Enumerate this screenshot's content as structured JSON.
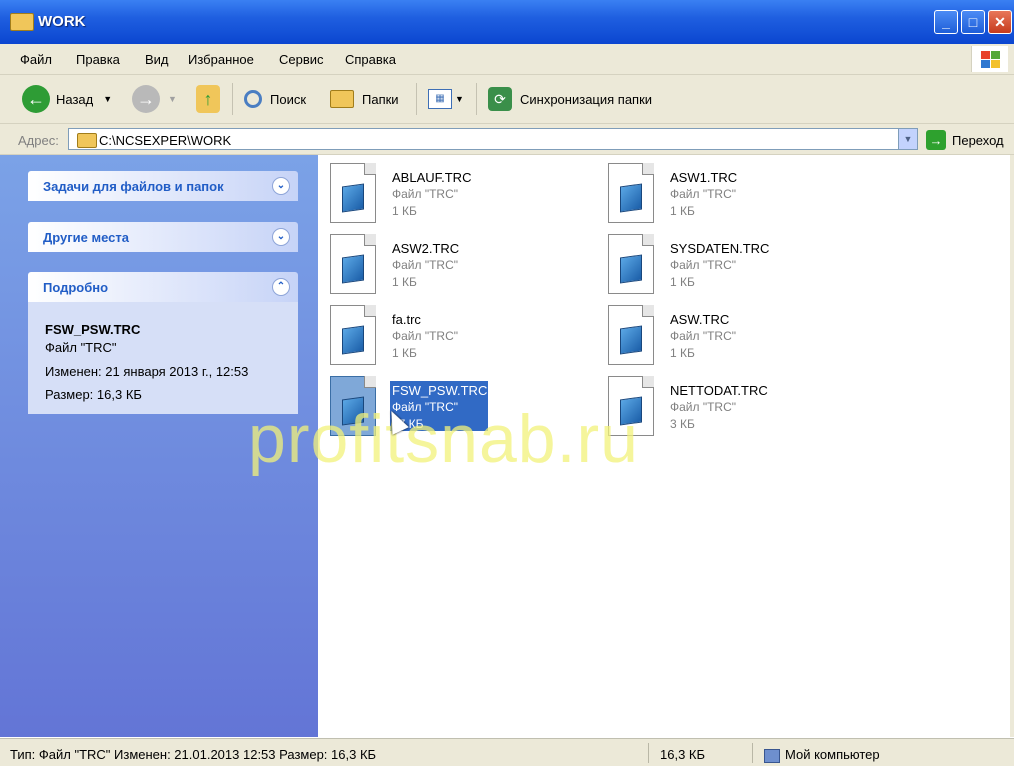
{
  "window": {
    "title": "WORK"
  },
  "menu": [
    "Файл",
    "Правка",
    "Вид",
    "Избранное",
    "Сервис",
    "Справка"
  ],
  "toolbar": {
    "back_label": "Назад",
    "search_label": "Поиск",
    "folders_label": "Папки",
    "sync_label": "Синхронизация папки"
  },
  "address": {
    "label": "Адрес:",
    "path": "C:\\NCSEXPER\\WORK",
    "go_label": "Переход"
  },
  "sidebar": {
    "tasks_title": "Задачи для файлов и папок",
    "other_title": "Другие места",
    "details_title": "Подробно",
    "details": {
      "name": "FSW_PSW.TRC",
      "type": "Файл \"TRC\"",
      "modified": "Изменен: 21 января 2013 г., 12:53",
      "size": "Размер: 16,3 КБ"
    }
  },
  "files": [
    {
      "name": "ABLAUF.TRC",
      "type": "Файл \"TRC\"",
      "size": "1 КБ",
      "selected": false
    },
    {
      "name": "ASW1.TRC",
      "type": "Файл \"TRC\"",
      "size": "1 КБ",
      "selected": false
    },
    {
      "name": "ASW2.TRC",
      "type": "Файл \"TRC\"",
      "size": "1 КБ",
      "selected": false
    },
    {
      "name": "SYSDATEN.TRC",
      "type": "Файл \"TRC\"",
      "size": "1 КБ",
      "selected": false
    },
    {
      "name": "fa.trc",
      "type": "Файл \"TRC\"",
      "size": "1 КБ",
      "selected": false
    },
    {
      "name": "ASW.TRC",
      "type": "Файл \"TRC\"",
      "size": "1 КБ",
      "selected": false
    },
    {
      "name": "FSW_PSW.TRC",
      "type": "Файл \"TRC\"",
      "size": "17 КБ",
      "selected": true
    },
    {
      "name": "NETTODAT.TRC",
      "type": "Файл \"TRC\"",
      "size": "3 КБ",
      "selected": false
    }
  ],
  "watermark": "profitsnab.ru",
  "status": {
    "info": "Тип: Файл \"TRC\" Изменен: 21.01.2013 12:53 Размер: 16,3 КБ",
    "size": "16,3 КБ",
    "location": "Мой компьютер"
  },
  "colors": {
    "titlebar": "#0b46d0",
    "sidebar": "#7ba2e7",
    "selection": "#316ac5",
    "panel_title": "#215dc6"
  }
}
